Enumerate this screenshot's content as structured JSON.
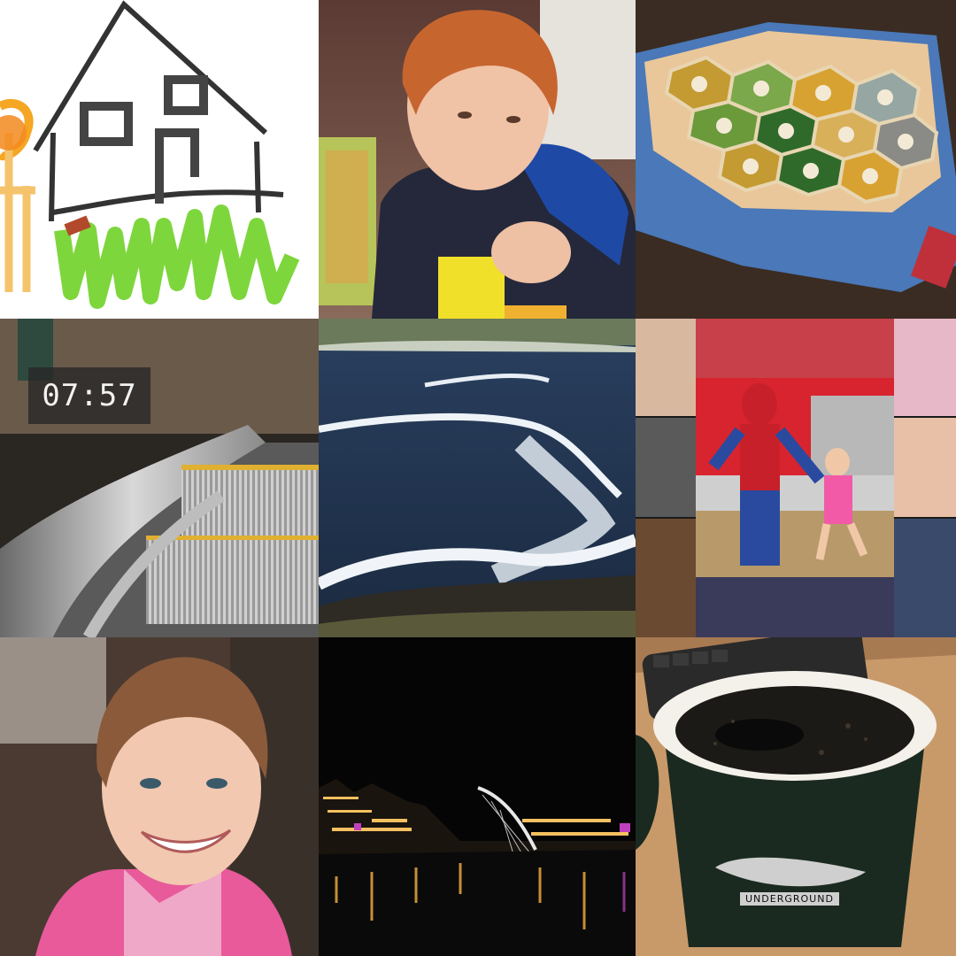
{
  "grid": {
    "columns": 3,
    "rows": 3,
    "tiles": [
      {
        "id": "drawing",
        "icon": "house-drawing"
      },
      {
        "id": "boy-puzzle",
        "icon": "child-photo"
      },
      {
        "id": "board-game",
        "icon": "hex-board-game"
      },
      {
        "id": "escalator",
        "icon": "escalator-photo",
        "clock_text": "07:57"
      },
      {
        "id": "ocean-waves",
        "icon": "wave-photo"
      },
      {
        "id": "kids-collage",
        "icon": "collage"
      },
      {
        "id": "girl-smile",
        "icon": "child-photo"
      },
      {
        "id": "night-city",
        "icon": "night-bridge"
      },
      {
        "id": "coffee-mug",
        "icon": "coffee-mug",
        "brand_text": "UNDERGROUND"
      }
    ]
  },
  "colors": {
    "background": "#ffffff",
    "green_grass": "#7ed63d",
    "ocean": "#1f3552",
    "board_blue": "#4a78b8",
    "spiderman_red": "#c8202a",
    "night": "#050505",
    "mug": "#1b2a20"
  }
}
